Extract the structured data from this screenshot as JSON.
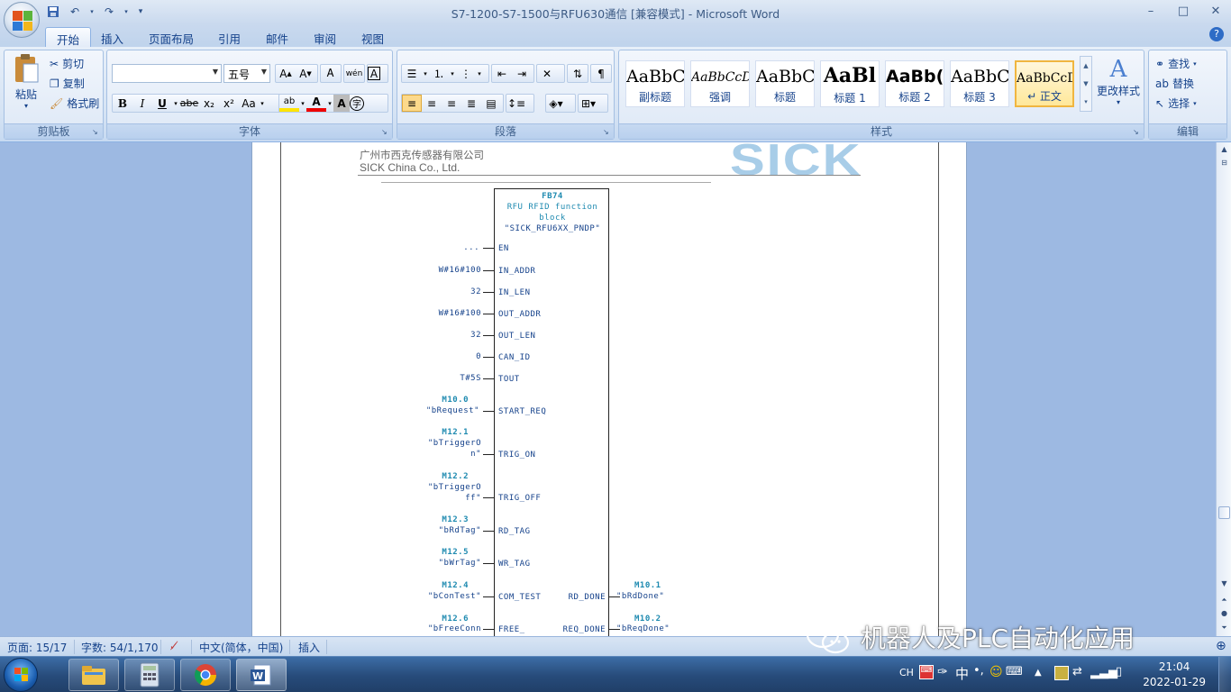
{
  "window": {
    "title": "S7-1200-S7-1500与RFU630通信 [兼容模式] - Microsoft Word",
    "minimize": "–",
    "maximize": "□",
    "close": "✕"
  },
  "tabs": [
    "开始",
    "插入",
    "页面布局",
    "引用",
    "邮件",
    "审阅",
    "视图"
  ],
  "ribbon": {
    "clipboard": {
      "label": "剪贴板",
      "paste": "粘贴",
      "cut": "剪切",
      "copy": "复制",
      "format_painter": "格式刷"
    },
    "font": {
      "label": "字体",
      "font_name": "",
      "font_size": "五号",
      "bold": "B",
      "italic": "I",
      "underline": "U",
      "strike": "abe",
      "sub": "x₂",
      "sup": "x²",
      "case": "Aa"
    },
    "paragraph": {
      "label": "段落"
    },
    "styles": {
      "label": "样式",
      "items": [
        {
          "preview": "AaBbC",
          "name": "副标题"
        },
        {
          "preview": "AaBbCcDd",
          "name": "强调"
        },
        {
          "preview": "AaBbC",
          "name": "标题"
        },
        {
          "preview": "AaBl",
          "name": "标题 1"
        },
        {
          "preview": "AaBb(",
          "name": "标题 2"
        },
        {
          "preview": "AaBbC",
          "name": "标题 3"
        },
        {
          "preview": "AaBbCcDc",
          "name": "↵ 正文"
        }
      ],
      "change_styles": "更改样式"
    },
    "editing": {
      "label": "编辑",
      "find": "查找",
      "replace": "替换",
      "select": "选择"
    }
  },
  "document": {
    "header_cn": "广州市西克传感器有限公司",
    "header_en": "SICK China Co., Ltd.",
    "logo_text": "SICK",
    "fb": {
      "name": "FB74",
      "desc1": "RFU RFID function",
      "desc2": "block",
      "instance": "\"SICK_RFU6XX_PNDP\""
    },
    "inputs": [
      {
        "value": "...",
        "pin": "EN"
      },
      {
        "value": "W#16#100",
        "pin": "IN_ADDR"
      },
      {
        "value": "32",
        "pin": "IN_LEN"
      },
      {
        "value": "W#16#100",
        "pin": "OUT_ADDR"
      },
      {
        "value": "32",
        "pin": "OUT_LEN"
      },
      {
        "value": "0",
        "pin": "CAN_ID"
      },
      {
        "value": "T#5S",
        "pin": "TOUT"
      },
      {
        "addr": "M10.0",
        "value": "\"bRequest\"",
        "pin": "START_REQ"
      },
      {
        "addr": "M12.1",
        "value": "\"bTriggerO",
        "value2": "n\"",
        "pin": "TRIG_ON"
      },
      {
        "addr": "M12.2",
        "value": "\"bTriggerO",
        "value2": "ff\"",
        "pin": "TRIG_OFF"
      },
      {
        "addr": "M12.3",
        "value": "\"bRdTag\"",
        "pin": "RD_TAG"
      },
      {
        "addr": "M12.5",
        "value": "\"bWrTag\"",
        "pin": "WR_TAG"
      },
      {
        "addr": "M12.4",
        "value": "\"bConTest\"",
        "pin": "COM_TEST"
      },
      {
        "addr": "M12.6",
        "value": "\"bFreeConn",
        "pin": "FREE_"
      }
    ],
    "outputs": [
      {
        "pin": "RD_DONE",
        "addr": "M10.1",
        "value": "\"bRdDone\""
      },
      {
        "pin": "REQ_DONE",
        "addr": "M10.2",
        "value": "\"bReqDone\""
      }
    ]
  },
  "status": {
    "page": "页面: 15/17",
    "words": "字数: 54/1,170",
    "language": "中文(简体，中国)",
    "insert": "插入"
  },
  "watermark": "机器人及PLC自动化应用",
  "taskbar": {
    "ime": "CH",
    "ime_mode": "中",
    "time": "21:04",
    "date": "2022-01-29"
  }
}
